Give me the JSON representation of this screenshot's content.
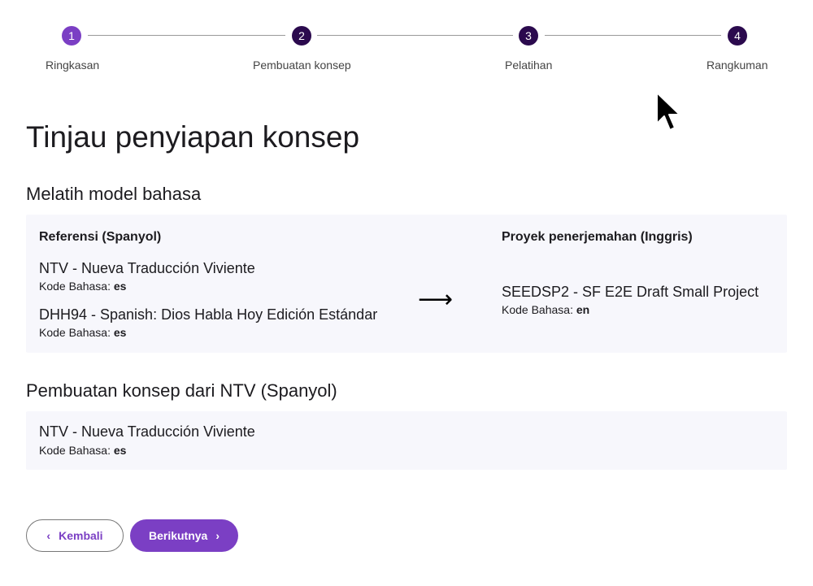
{
  "stepper": {
    "steps": [
      {
        "number": "1",
        "label": "Ringkasan"
      },
      {
        "number": "2",
        "label": "Pembuatan konsep"
      },
      {
        "number": "3",
        "label": "Pelatihan"
      },
      {
        "number": "4",
        "label": "Rangkuman"
      }
    ]
  },
  "page": {
    "title": "Tinjau penyiapan konsep"
  },
  "training": {
    "title": "Melatih model bahasa",
    "reference_header": "Referensi (Spanyol)",
    "target_header": "Proyek penerjemahan (Inggris)",
    "language_code_label": "Kode Bahasa:",
    "references": [
      {
        "name": "NTV - Nueva Traducción Viviente",
        "code": "es"
      },
      {
        "name": "DHH94 - Spanish: Dios Habla Hoy Edición Estándar",
        "code": "es"
      }
    ],
    "target": {
      "name": "SEEDSP2 - SF E2E Draft Small Project",
      "code": "en"
    },
    "arrow": "⟶"
  },
  "drafting": {
    "title": "Pembuatan konsep dari NTV (Spanyol)",
    "language_code_label": "Kode Bahasa:",
    "source": {
      "name": "NTV - Nueva Traducción Viviente",
      "code": "es"
    }
  },
  "nav": {
    "back_label": "Kembali",
    "next_label": "Berikutnya",
    "back_chevron": "‹",
    "next_chevron": "›"
  },
  "colors": {
    "accent": "#7b3fc4",
    "active_step": "#2b0a4e",
    "card_bg": "#f7f7fc"
  }
}
